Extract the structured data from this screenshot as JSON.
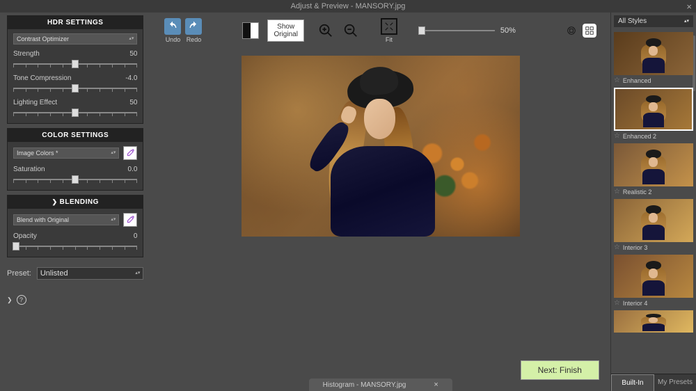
{
  "titlebar": {
    "title": "Adjust & Preview - MANSORY.jpg"
  },
  "hdr": {
    "header": "HDR SETTINGS",
    "mode": "Contrast Optimizer",
    "strength": {
      "label": "Strength",
      "value": "50",
      "pos": 50
    },
    "tone": {
      "label": "Tone Compression",
      "value": "-4.0",
      "pos": 50
    },
    "lighting": {
      "label": "Lighting Effect",
      "value": "50",
      "pos": 50
    }
  },
  "color": {
    "header": "COLOR SETTINGS",
    "mode": "Image Colors *",
    "saturation": {
      "label": "Saturation",
      "value": "0.0",
      "pos": 50
    }
  },
  "blend": {
    "header": "BLENDING",
    "mode": "Blend with Original",
    "opacity": {
      "label": "Opacity",
      "value": "0",
      "pos": 2
    }
  },
  "preset": {
    "label": "Preset:",
    "value": "Unlisted"
  },
  "toolbar": {
    "undo": "Undo",
    "redo": "Redo",
    "show_original": "Show Original",
    "fit": "Fit",
    "zoom": "50%"
  },
  "styles": {
    "dropdown": "All Styles",
    "items": [
      {
        "name": "Enhanced"
      },
      {
        "name": "Enhanced 2",
        "selected": true
      },
      {
        "name": "Realistic 2"
      },
      {
        "name": "Interior 3"
      },
      {
        "name": "Interior 4"
      },
      {
        "name": ""
      }
    ],
    "tabs": {
      "builtin": "Built-In",
      "mypresets": "My Presets"
    }
  },
  "next": "Next: Finish",
  "histogram": "Histogram - MANSORY.jpg"
}
